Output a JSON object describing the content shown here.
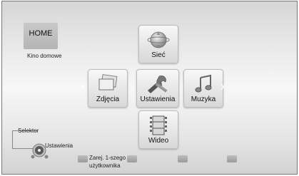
{
  "home": {
    "label": "HOME",
    "subtitle": "Kino domowe"
  },
  "menu": {
    "top": {
      "label": "Sieć",
      "icon": "globe-icon"
    },
    "left": {
      "label": "Zdjęcia",
      "icon": "photos-icon"
    },
    "center": {
      "label": "Ustawienia",
      "icon": "tools-icon"
    },
    "right": {
      "label": "Muzyka",
      "icon": "music-note-icon"
    },
    "bottom": {
      "label": "Wideo",
      "icon": "film-icon"
    },
    "arrow_left": "‹",
    "arrow_right": "›"
  },
  "selector": {
    "label": "Selektor",
    "current": "Ustawienia"
  },
  "color_buttons": {
    "first_label_line1": "Zarej. 1-szego",
    "first_label_line2": "użytkownika"
  }
}
